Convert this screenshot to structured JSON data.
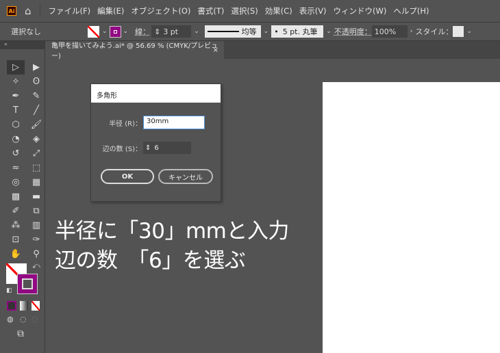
{
  "menubar": {
    "logo": "Ai",
    "items": [
      "ファイル(F)",
      "編集(E)",
      "オブジェクト(O)",
      "書式(T)",
      "選択(S)",
      "効果(C)",
      "表示(V)",
      "ウィンドウ(W)",
      "ヘルプ(H)"
    ]
  },
  "control": {
    "selection": "選択なし",
    "stroke_label": "線：",
    "stroke_value": "3 pt",
    "line_style": "均等",
    "brush": "5 pt. 丸筆",
    "opacity_label": "不透明度：",
    "opacity_value": "100%",
    "style_label": "スタイル："
  },
  "tab": {
    "title": "亀甲を描いてみよう.ai* @ 56.69 % (CMYK/プレビュー)",
    "close": "×"
  },
  "dialog": {
    "title": "多角形",
    "radius_label": "半径 (R)：",
    "radius_value": "30mm",
    "sides_label": "辺の数 (S)：",
    "sides_value": "6",
    "ok": "OK",
    "cancel": "キャンセル"
  },
  "caption": {
    "line1": "半径に「30」mmと入力",
    "line2": "辺の数　「6」を選ぶ"
  },
  "colors": {
    "fill": "#ffffff",
    "stroke": "#920783",
    "accent": "#4a90d9"
  }
}
